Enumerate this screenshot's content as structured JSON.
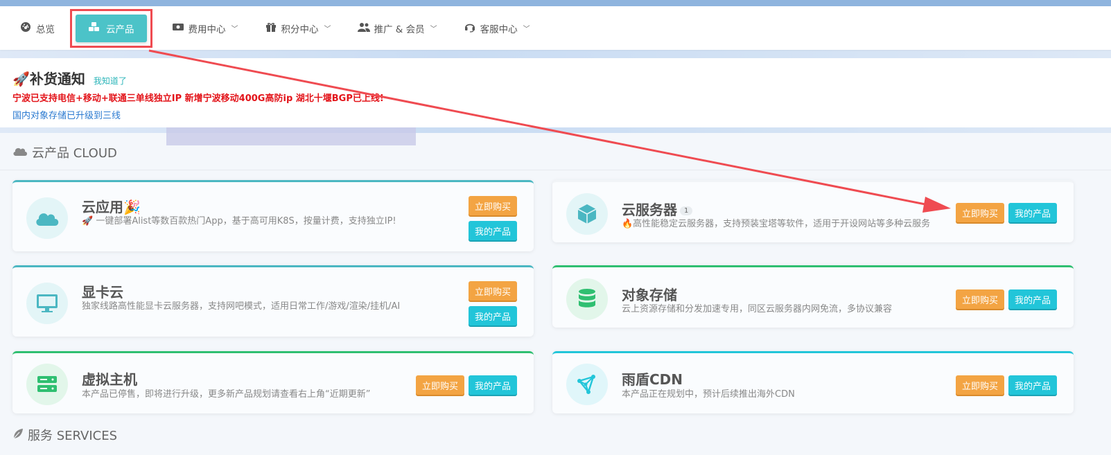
{
  "nav": {
    "items": [
      {
        "label": "总览",
        "icon": "dashboard-icon"
      },
      {
        "label": "云产品",
        "icon": "cubes-icon",
        "active": true
      },
      {
        "label": "费用中心",
        "icon": "money-icon",
        "dropdown": true
      },
      {
        "label": "积分中心",
        "icon": "gift-icon",
        "dropdown": true
      },
      {
        "label": "推广 & 会员",
        "icon": "users-icon",
        "dropdown": true
      },
      {
        "label": "客服中心",
        "icon": "headset-icon",
        "dropdown": true
      }
    ]
  },
  "notice": {
    "title": "🚀补货通知",
    "ack": "我知道了",
    "line1": "宁波已支持电信+移动+联通三单线独立IP 新增宁波移动400G高防ip 湖北十堰BGP已上线!",
    "line2": "国内对象存储已升级到三线"
  },
  "sections": {
    "cloud": "云产品 CLOUD",
    "services": "服务 SERVICES"
  },
  "cards": [
    {
      "title": "云应用🎉",
      "desc": "🚀 一键部署Alist等数百款热门App，基于高可用K8S，按量计费，支持独立IP!",
      "buy": "立即购买",
      "mine": "我的产品"
    },
    {
      "title": "云服务器",
      "badge": "1",
      "desc": "🔥高性能稳定云服务器，支持预装宝塔等软件，适用于开设网站等多种云服务",
      "buy": "立即购买",
      "mine": "我的产品"
    },
    {
      "title": "显卡云",
      "desc": "独家线路高性能显卡云服务器，支持网吧模式，适用日常工作/游戏/渲染/挂机/AI",
      "buy": "立即购买",
      "mine": "我的产品"
    },
    {
      "title": "对象存储",
      "desc": "云上资源存储和分发加速专用，同区云服务器内网免流，多协议兼容",
      "buy": "立即购买",
      "mine": "我的产品"
    },
    {
      "title": "虚拟主机",
      "desc": "本产品已停售，即将进行升级，更多新产品规划请查看右上角“近期更新”",
      "buy": "立即购买",
      "mine": "我的产品"
    },
    {
      "title": "雨盾CDN",
      "desc": "本产品正在规划中，预计后续推出海外CDN",
      "buy": "立即购买",
      "mine": "我的产品"
    }
  ],
  "colors": {
    "accent": "#4cc3c8",
    "buy": "#f3a443",
    "mine": "#22c5d9",
    "highlight_red": "#ef4b51",
    "notice_red": "#e3141a",
    "notice_blue": "#2a79d0"
  }
}
